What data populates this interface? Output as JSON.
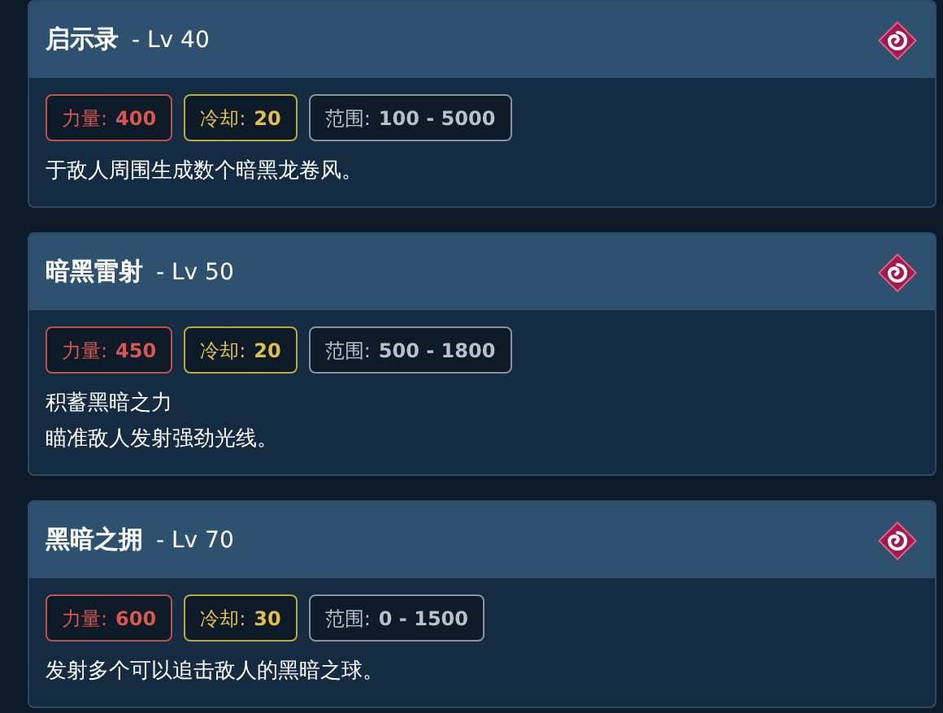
{
  "skills": [
    {
      "name": "启示录",
      "level": "- Lv 40",
      "stats": [
        {
          "kind": "power",
          "label": "力量:",
          "value": "400"
        },
        {
          "kind": "cooldown",
          "label": "冷却:",
          "value": "20"
        },
        {
          "kind": "range",
          "label": "范围:",
          "value": "100 - 5000"
        }
      ],
      "description": [
        "于敌人周围生成数个暗黑龙卷风。"
      ]
    },
    {
      "name": "暗黑雷射",
      "level": "- Lv 50",
      "stats": [
        {
          "kind": "power",
          "label": "力量:",
          "value": "450"
        },
        {
          "kind": "cooldown",
          "label": "冷却:",
          "value": "20"
        },
        {
          "kind": "range",
          "label": "范围:",
          "value": "500 - 1800"
        }
      ],
      "description": [
        "积蓄黑暗之力",
        "瞄准敌人发射强劲光线。"
      ]
    },
    {
      "name": "黑暗之拥",
      "level": "- Lv 70",
      "stats": [
        {
          "kind": "power",
          "label": "力量:",
          "value": "600"
        },
        {
          "kind": "cooldown",
          "label": "冷却:",
          "value": "30"
        },
        {
          "kind": "range",
          "label": "范围:",
          "value": "0 - 1500"
        }
      ],
      "description": [
        "发射多个可以追击敌人的黑暗之球。"
      ]
    }
  ]
}
